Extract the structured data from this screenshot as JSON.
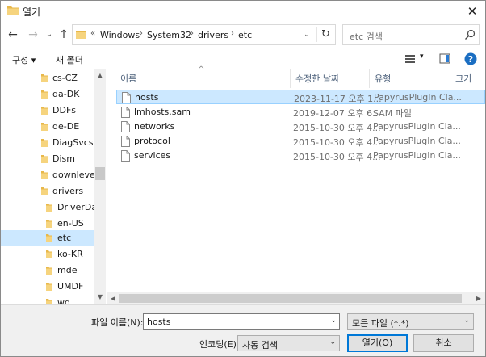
{
  "window": {
    "title": "열기",
    "close_glyph": "✕"
  },
  "nav": {
    "back_glyph": "←",
    "forward_glyph": "→",
    "recent_glyph": "⌄",
    "up_glyph": "↑",
    "path_overflow": "«",
    "breadcrumbs": [
      "Windows",
      "System32",
      "drivers",
      "etc"
    ],
    "crumb_sep": "›",
    "dropdown_glyph": "⌄",
    "refresh_glyph": "↻",
    "search_placeholder": "etc 검색"
  },
  "toolbar": {
    "organize_label": "구성 ▾",
    "new_folder_label": "새 폴더",
    "view_dd": "▾",
    "help_glyph": "?"
  },
  "sidebar": {
    "items": [
      {
        "label": "cs-CZ",
        "selected": false,
        "level": 0
      },
      {
        "label": "da-DK",
        "selected": false,
        "level": 0
      },
      {
        "label": "DDFs",
        "selected": false,
        "level": 0
      },
      {
        "label": "de-DE",
        "selected": false,
        "level": 0
      },
      {
        "label": "DiagSvcs",
        "selected": false,
        "level": 0
      },
      {
        "label": "Dism",
        "selected": false,
        "level": 0
      },
      {
        "label": "downlevel",
        "selected": false,
        "level": 0
      },
      {
        "label": "drivers",
        "selected": false,
        "level": 0
      },
      {
        "label": "DriverData",
        "selected": false,
        "level": 1
      },
      {
        "label": "en-US",
        "selected": false,
        "level": 1
      },
      {
        "label": "etc",
        "selected": true,
        "level": 1
      },
      {
        "label": "ko-KR",
        "selected": false,
        "level": 1
      },
      {
        "label": "mde",
        "selected": false,
        "level": 1
      },
      {
        "label": "UMDF",
        "selected": false,
        "level": 1
      },
      {
        "label": "wd",
        "selected": false,
        "level": 1
      }
    ],
    "scroll_up": "▲",
    "scroll_down": "▼"
  },
  "files": {
    "columns": {
      "name": "이름",
      "date": "수정한 날짜",
      "type": "유형",
      "size": "크기"
    },
    "sort_indicator": "^",
    "rows": [
      {
        "name": "hosts",
        "date": "2023-11-17 오후 1...",
        "type": "PapyrusPlugIn Cla...",
        "selected": true
      },
      {
        "name": "lmhosts.sam",
        "date": "2019-12-07 오후 6...",
        "type": "SAM 파일",
        "selected": false
      },
      {
        "name": "networks",
        "date": "2015-10-30 오후 4...",
        "type": "PapyrusPlugIn Cla...",
        "selected": false
      },
      {
        "name": "protocol",
        "date": "2015-10-30 오후 4...",
        "type": "PapyrusPlugIn Cla...",
        "selected": false
      },
      {
        "name": "services",
        "date": "2015-10-30 오후 4...",
        "type": "PapyrusPlugIn Cla...",
        "selected": false
      }
    ],
    "scroll_left": "◀",
    "scroll_right": "▶"
  },
  "bottom": {
    "filename_label": "파일 이름(N):",
    "filename_value": "hosts",
    "filter_value": "모든 파일 (*.*)",
    "encoding_label": "인코딩(E):",
    "encoding_value": "자동 검색",
    "open_label": "열기(O)",
    "cancel_label": "취소",
    "dropdown_glyph": "⌄"
  },
  "colors": {
    "accent": "#0078d7",
    "selection": "#cce8ff",
    "folder": "#e8b84a"
  }
}
